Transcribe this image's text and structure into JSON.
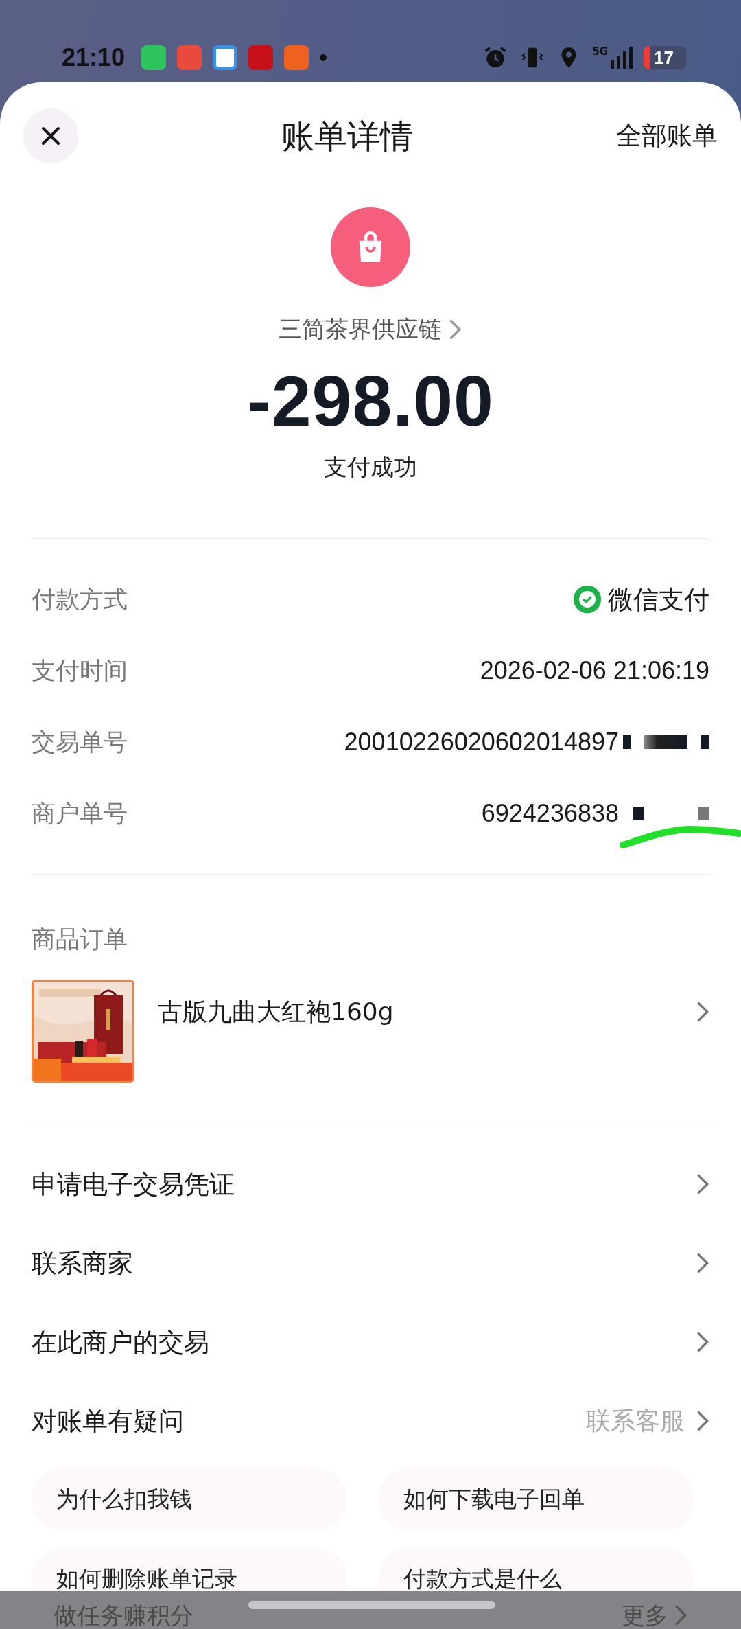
{
  "status_bar": {
    "time": "21:10",
    "battery": "17",
    "network": "5G"
  },
  "header": {
    "title": "账单详情",
    "right_link": "全部账单"
  },
  "summary": {
    "merchant": "三简茶界供应链",
    "amount": "-298.00",
    "status": "支付成功"
  },
  "details": [
    {
      "label": "付款方式",
      "value": "微信支付",
      "kind": "payment"
    },
    {
      "label": "支付时间",
      "value": "2026-02-06 21:06:19",
      "kind": "text"
    },
    {
      "label": "交易单号",
      "value": "20010226020602014897",
      "kind": "text",
      "redacted": true
    },
    {
      "label": "商户单号",
      "value": "6924236838",
      "kind": "text",
      "redacted": true,
      "marker_stroke": true
    }
  ],
  "order": {
    "title": "商品订单",
    "product": {
      "name": "古版九曲大红袍160g"
    }
  },
  "actions": [
    {
      "label": "申请电子交易凭证"
    },
    {
      "label": "联系商家"
    },
    {
      "label": "在此商户的交易"
    },
    {
      "label": "对账单有疑问",
      "hint": "联系客服"
    }
  ],
  "faq": [
    "为什么扣我钱",
    "如何下载电子回单",
    "如何删除账单记录",
    "付款方式是什么"
  ],
  "bottom_bar": {
    "label": "做任务赚积分",
    "more": "更多"
  }
}
